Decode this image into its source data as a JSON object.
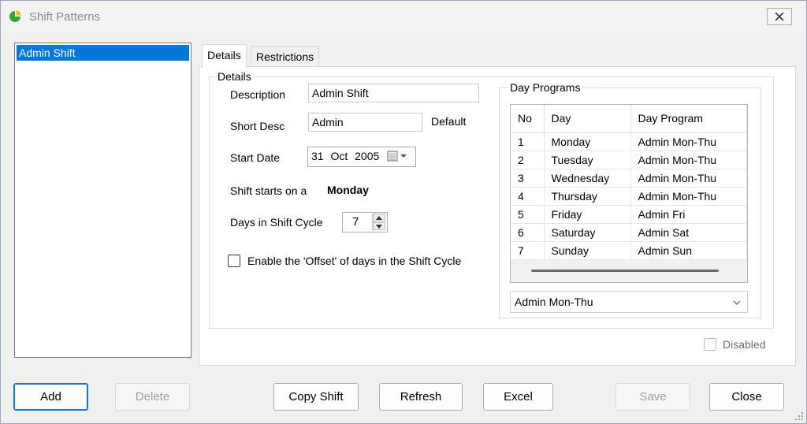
{
  "window": {
    "title": "Shift Patterns"
  },
  "shift_list": {
    "items": [
      "Admin Shift"
    ],
    "selected": 0
  },
  "tabs": [
    {
      "label": "Details",
      "active": true
    },
    {
      "label": "Restrictions",
      "active": false
    }
  ],
  "details": {
    "group_title": "Details",
    "description_label": "Description",
    "description_value": "Admin Shift",
    "short_desc_label": "Short Desc",
    "short_desc_value": "Admin",
    "default_label": "Default",
    "start_date_label": "Start Date",
    "start_date_day": "31",
    "start_date_month": "Oct",
    "start_date_year": "2005",
    "shift_starts_label": "Shift starts on a",
    "shift_starts_value": "Monday",
    "days_cycle_label": "Days in Shift Cycle",
    "days_cycle_value": "7",
    "offset_label": "Enable the 'Offset' of days in the Shift Cycle",
    "offset_checked": false
  },
  "day_programs": {
    "group_title": "Day Programs",
    "columns": [
      "No",
      "Day",
      "Day Program"
    ],
    "rows": [
      [
        "1",
        "Monday",
        "Admin Mon-Thu"
      ],
      [
        "2",
        "Tuesday",
        "Admin Mon-Thu"
      ],
      [
        "3",
        "Wednesday",
        "Admin Mon-Thu"
      ],
      [
        "4",
        "Thursday",
        "Admin Mon-Thu"
      ],
      [
        "5",
        "Friday",
        "Admin Fri"
      ],
      [
        "6",
        "Saturday",
        "Admin Sat"
      ],
      [
        "7",
        "Sunday",
        "Admin Sun"
      ]
    ],
    "selected_program": "Admin Mon-Thu"
  },
  "disabled_label": "Disabled",
  "buttons": {
    "add": "Add",
    "delete": "Delete",
    "copy_shift": "Copy Shift",
    "refresh": "Refresh",
    "excel": "Excel",
    "save": "Save",
    "close": "Close"
  },
  "colors": {
    "selection": "#0078d7",
    "default_button_border": "#0078d7",
    "app_icon": "#3aa335"
  }
}
